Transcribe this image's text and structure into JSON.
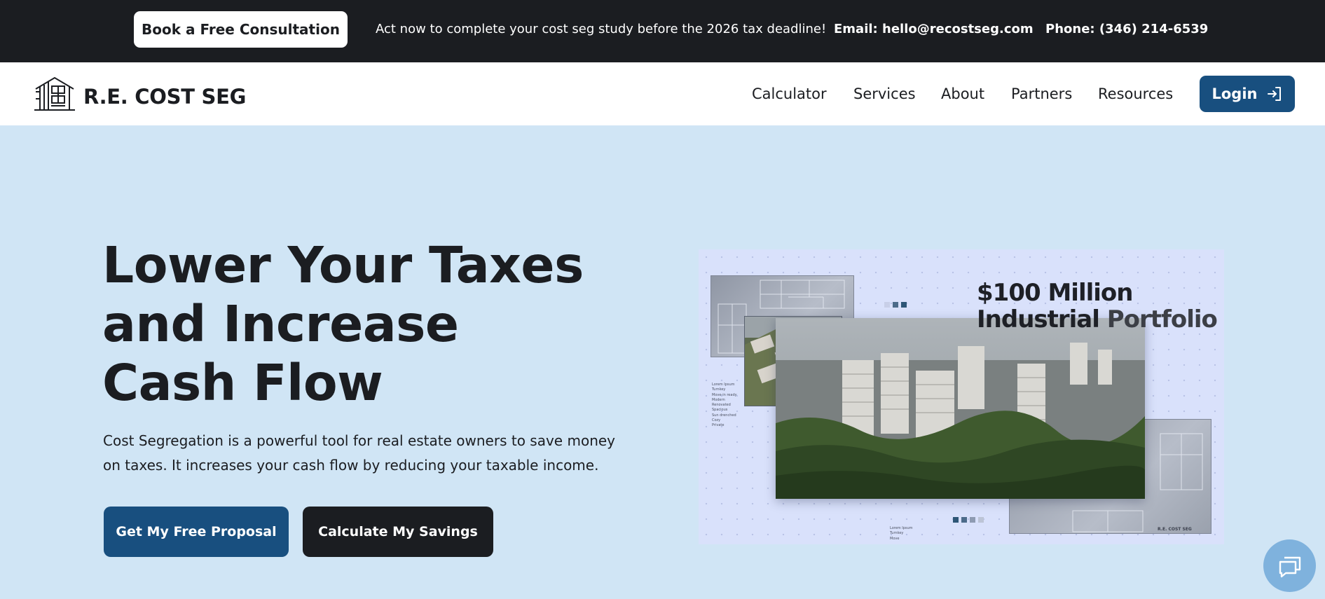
{
  "topbar": {
    "consult_label": "Book a Free Consultation",
    "promo": "Act now to complete your cost seg study before the 2026 tax deadline!",
    "email": "Email: hello@recostseg.com",
    "phone": "Phone: (346) 214-6539"
  },
  "header": {
    "logo_text": "R.E. COST SEG",
    "logo_icon": "building-outline-icon",
    "nav": [
      {
        "label": "Calculator"
      },
      {
        "label": "Services"
      },
      {
        "label": "About"
      },
      {
        "label": "Partners"
      },
      {
        "label": "Resources"
      }
    ],
    "login_label": "Login",
    "login_icon": "sign-in-arrow-icon"
  },
  "hero": {
    "title_lines": [
      "Lower Your Taxes",
      "and Increase",
      "Cash Flow"
    ],
    "description": "Cost Segregation is a powerful tool for real estate owners to save money on taxes. It increases your cash flow by reducing your taxable income.",
    "cta_primary": "Get My Free Proposal",
    "cta_secondary": "Calculate My Savings"
  },
  "hero_image": {
    "title_line1": "$100 Million",
    "title_line2a": "Industrial",
    "title_line2b": "Portfolio",
    "side_list": [
      "Lorem Ipsum",
      "Turnkey",
      "Move-in ready",
      "Modern",
      "Renovated",
      "Spacious",
      "Sun drenched",
      "Cozy",
      "Private"
    ],
    "bottom_list": [
      "Lorem Ipsum",
      "Turnkey",
      "Move"
    ],
    "mini_logo": "R.E. COST SEG"
  },
  "colors": {
    "topbar_bg": "#1b1d21",
    "hero_bg": "#d0e5f5",
    "primary": "#184f7f",
    "dark": "#1b1d21",
    "chat_bg": "#7fb2dd"
  },
  "chat": {
    "icon": "chat-bubbles-icon"
  }
}
